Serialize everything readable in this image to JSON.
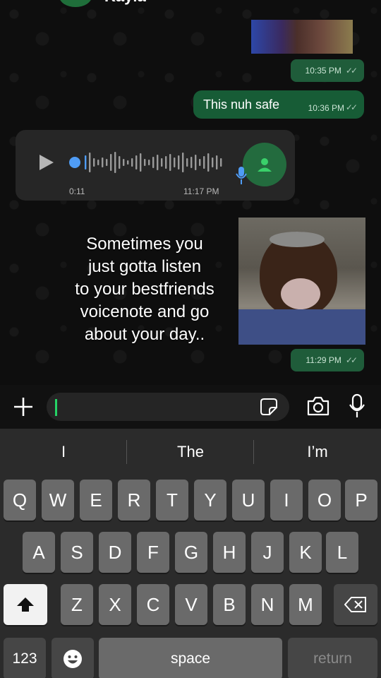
{
  "header": {
    "contact_name": "Kayla"
  },
  "messages": {
    "time_1035": "10:35 PM",
    "out_text": "This nuh safe",
    "time_1036": "10:36 PM",
    "voice_duration": "0:11",
    "voice_time": "11:17 PM",
    "time_1129": "11:29 PM",
    "ticks": "✓✓"
  },
  "caption": {
    "lines": [
      "Sometimes you",
      "just gotta listen",
      "to your bestfriends",
      "voicenote and go",
      "about your day.."
    ]
  },
  "keyboard": {
    "suggestions": [
      "I",
      "The",
      "I’m"
    ],
    "row1": [
      "Q",
      "W",
      "E",
      "R",
      "T",
      "Y",
      "U",
      "I",
      "O",
      "P"
    ],
    "row2": [
      "A",
      "S",
      "D",
      "F",
      "G",
      "H",
      "J",
      "K",
      "L"
    ],
    "row3": [
      "Z",
      "X",
      "C",
      "V",
      "B",
      "N",
      "M"
    ],
    "numbers_key": "123",
    "space_key": "space",
    "return_key": "return"
  },
  "colors": {
    "outgoing_bubble": "#175c36",
    "caret": "#25d366",
    "progress_dot": "#4f9cf5"
  },
  "icons": [
    "back-chevron-icon",
    "video-call-icon",
    "phone-icon",
    "play-icon",
    "mic-icon",
    "contact-icon",
    "plus-icon",
    "sticker-icon",
    "camera-icon",
    "shift-icon",
    "backspace-icon",
    "emoji-icon"
  ]
}
